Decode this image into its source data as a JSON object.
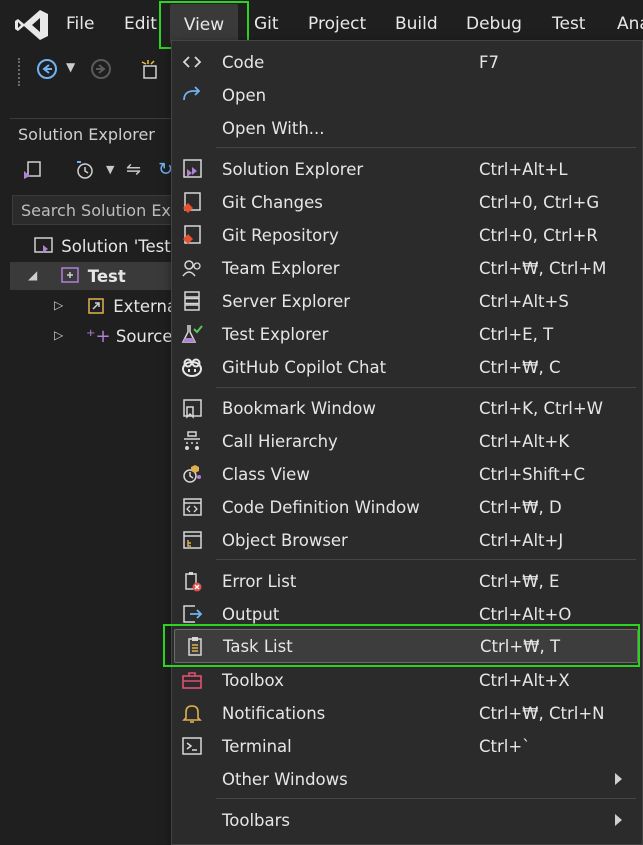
{
  "menubar": {
    "items": [
      "File",
      "Edit",
      "View",
      "Git",
      "Project",
      "Build",
      "Debug",
      "Test",
      "Ana"
    ],
    "active": "View"
  },
  "solution_explorer": {
    "title": "Solution Explorer",
    "search_placeholder": "Search Solution Ex",
    "nodes": [
      "Solution 'Test",
      "Test",
      "Externa",
      "Source"
    ]
  },
  "view_menu": {
    "items": [
      {
        "label": "Code",
        "shortcut": "F7",
        "icon": "code-icon"
      },
      {
        "label": "Open",
        "shortcut": "",
        "icon": "open-arrow-icon"
      },
      {
        "label": "Open With...",
        "shortcut": "",
        "icon": ""
      },
      {
        "label": "Solution Explorer",
        "shortcut": "Ctrl+Alt+L",
        "icon": "solution-explorer-icon"
      },
      {
        "label": "Git Changes",
        "shortcut": "Ctrl+0, Ctrl+G",
        "icon": "git-changes-icon"
      },
      {
        "label": "Git Repository",
        "shortcut": "Ctrl+0, Ctrl+R",
        "icon": "git-repository-icon"
      },
      {
        "label": "Team Explorer",
        "shortcut": "Ctrl+₩, Ctrl+M",
        "icon": "team-explorer-icon"
      },
      {
        "label": "Server Explorer",
        "shortcut": "Ctrl+Alt+S",
        "icon": "server-explorer-icon"
      },
      {
        "label": "Test Explorer",
        "shortcut": "Ctrl+E, T",
        "icon": "test-explorer-icon"
      },
      {
        "label": "GitHub Copilot Chat",
        "shortcut": "Ctrl+₩, C",
        "icon": "copilot-icon"
      },
      {
        "label": "Bookmark Window",
        "shortcut": "Ctrl+K, Ctrl+W",
        "icon": "bookmark-icon"
      },
      {
        "label": "Call Hierarchy",
        "shortcut": "Ctrl+Alt+K",
        "icon": "call-hierarchy-icon"
      },
      {
        "label": "Class View",
        "shortcut": "Ctrl+Shift+C",
        "icon": "class-view-icon"
      },
      {
        "label": "Code Definition Window",
        "shortcut": "Ctrl+₩, D",
        "icon": "code-definition-icon"
      },
      {
        "label": "Object Browser",
        "shortcut": "Ctrl+Alt+J",
        "icon": "object-browser-icon"
      },
      {
        "label": "Error List",
        "shortcut": "Ctrl+₩, E",
        "icon": "error-list-icon"
      },
      {
        "label": "Output",
        "shortcut": "Ctrl+Alt+O",
        "icon": "output-icon"
      },
      {
        "label": "Task List",
        "shortcut": "Ctrl+₩, T",
        "icon": "task-list-icon"
      },
      {
        "label": "Toolbox",
        "shortcut": "Ctrl+Alt+X",
        "icon": "toolbox-icon"
      },
      {
        "label": "Notifications",
        "shortcut": "Ctrl+₩, Ctrl+N",
        "icon": "bell-icon"
      },
      {
        "label": "Terminal",
        "shortcut": "Ctrl+`",
        "icon": "terminal-icon"
      },
      {
        "label": "Other Windows",
        "shortcut": "",
        "icon": ""
      },
      {
        "label": "Toolbars",
        "shortcut": "",
        "icon": ""
      }
    ],
    "highlighted": "Task List"
  },
  "colors": {
    "highlight_outline": "#2dd41f",
    "menu_bg": "#2b2b2b",
    "hover_bg": "#3d3d3d",
    "vs_purple": "#b180d7"
  }
}
